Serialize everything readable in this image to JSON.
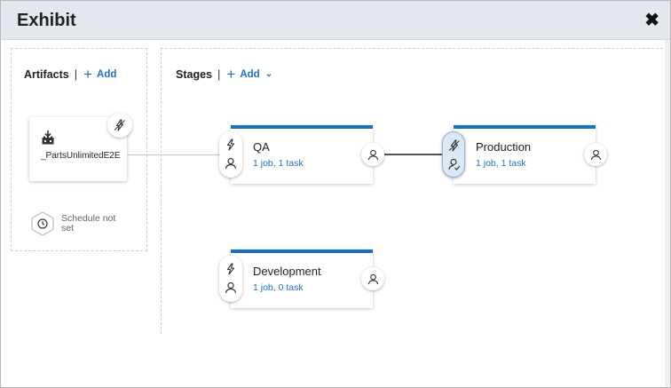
{
  "window": {
    "title": "Exhibit",
    "close_label": "✖"
  },
  "artifacts": {
    "header": "Artifacts",
    "separator": "|",
    "add_label": "Add",
    "card": {
      "name": "_PartsUnlimitedE2E",
      "icon": "build-icon",
      "trigger_icon": "continuous-deployment-trigger-icon"
    },
    "schedule": {
      "text": "Schedule not set",
      "icon": "clock-icon"
    }
  },
  "stages": {
    "header": "Stages",
    "separator": "|",
    "add_label": "Add",
    "items": [
      {
        "name": "QA",
        "meta": "1 job, 1 task",
        "pre_active": false
      },
      {
        "name": "Production",
        "meta": "1 job, 1 task",
        "pre_active": true
      },
      {
        "name": "Development",
        "meta": "1 job, 0 task",
        "pre_active": false
      }
    ]
  },
  "colors": {
    "accent": "#1a6fc0",
    "link": "#1f6fc5",
    "titlebar": "#e4e8ee"
  }
}
